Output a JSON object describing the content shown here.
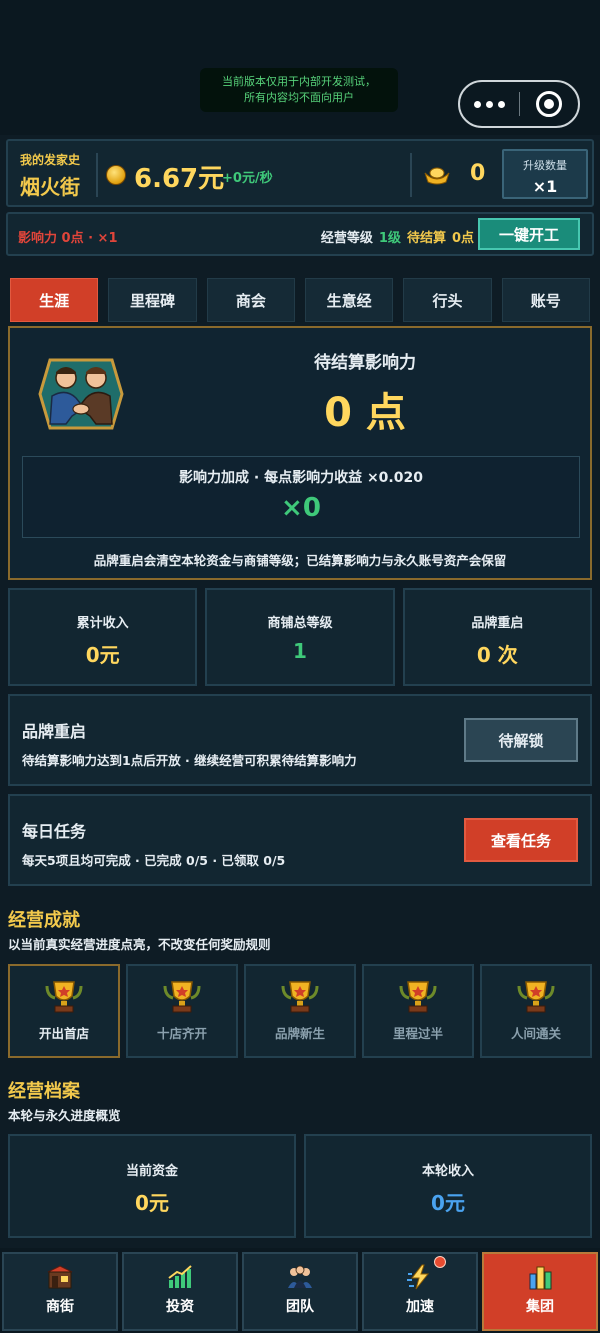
{
  "notice": {
    "line1": "当前版本仅用于内部开发测试，",
    "line2": "所有内容均不面向用户"
  },
  "status": {
    "subtitle": "我的发家史",
    "title": "烟火街",
    "money": "6.67元",
    "rate": "+0元/秒",
    "ingots": "0",
    "upgrade_label": "升级数量",
    "upgrade_value": "×1"
  },
  "info": {
    "influence": "影响力 0点 · ×1",
    "level_label": "经营等级",
    "level_value": "1级",
    "pending_label": "待结算",
    "pending_value": "0点",
    "start_button": "一键开工"
  },
  "tabs": [
    "生涯",
    "里程碑",
    "商会",
    "生意经",
    "行头",
    "账号"
  ],
  "hero": {
    "label": "待结算影响力",
    "points": "0 点",
    "bonus_label": "影响力加成 · 每点影响力收益 ×0.020",
    "bonus_value": "×0",
    "note": "品牌重启会清空本轮资金与商铺等级；已结算影响力与永久账号资产会保留"
  },
  "stats": [
    {
      "label": "累计收入",
      "value": "0元"
    },
    {
      "label": "商铺总等级",
      "value": "1"
    },
    {
      "label": "品牌重启",
      "value": "0 次"
    }
  ],
  "restart_panel": {
    "title": "品牌重启",
    "desc": "待结算影响力达到1点后开放 · 继续经营可积累待结算影响力",
    "button": "待解锁"
  },
  "daily_panel": {
    "title": "每日任务",
    "desc": "每天5项且均可完成 · 已完成 0/5 · 已领取 0/5",
    "button": "查看任务"
  },
  "achievements": {
    "title": "经营成就",
    "subtitle": "以当前真实经营进度点亮，不改变任何奖励规则",
    "items": [
      "开出首店",
      "十店齐开",
      "品牌新生",
      "里程过半",
      "人间通关"
    ]
  },
  "archive": {
    "title": "经营档案",
    "subtitle": "本轮与永久进度概览",
    "items": [
      {
        "label": "当前资金",
        "value": "0元"
      },
      {
        "label": "本轮收入",
        "value": "0元"
      }
    ]
  },
  "nav": [
    "商街",
    "投资",
    "团队",
    "加速",
    "集团"
  ],
  "colors": {
    "accent_red": "#d13f28",
    "gold": "#ffd75e",
    "green": "#3fc97a",
    "blue": "#4aa3f0"
  }
}
